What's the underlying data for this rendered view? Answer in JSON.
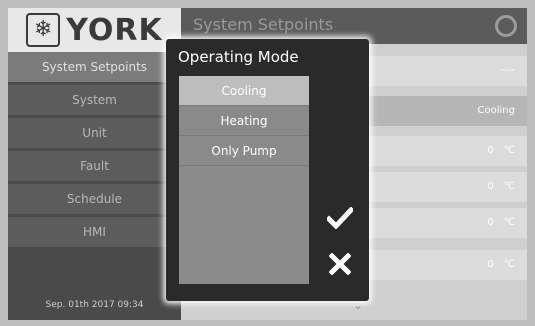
{
  "brand": {
    "logo_text": "YORK",
    "logo_icon": "snowflake-icon"
  },
  "sidebar": {
    "items": [
      {
        "label": "System Setpoints",
        "active": true
      },
      {
        "label": "System"
      },
      {
        "label": "Unit"
      },
      {
        "label": "Fault"
      },
      {
        "label": "Schedule"
      },
      {
        "label": "HMI"
      }
    ],
    "datetime": "Sep. 01th 2017  09:34"
  },
  "header": {
    "title": "System Setpoints",
    "status_icon": "status-ring-icon"
  },
  "rows": [
    {
      "value": "----",
      "unit": ""
    },
    {
      "value": "Cooling",
      "unit": ""
    },
    {
      "value": "0",
      "unit": "℃"
    },
    {
      "value": "0",
      "unit": "℃"
    },
    {
      "value": "0",
      "unit": "℃"
    },
    {
      "value": "0",
      "unit": "℃"
    }
  ],
  "modal": {
    "title": "Operating Mode",
    "options": [
      "Cooling",
      "Heating",
      "Only Pump"
    ],
    "selected": "Cooling",
    "confirm_icon": "checkmark-icon",
    "cancel_icon": "x-icon"
  },
  "colors": {
    "modal_bg": "#2a2a2a",
    "selected_option": "#bdbdbd",
    "sidebar_bg": "#4a4a4a"
  }
}
